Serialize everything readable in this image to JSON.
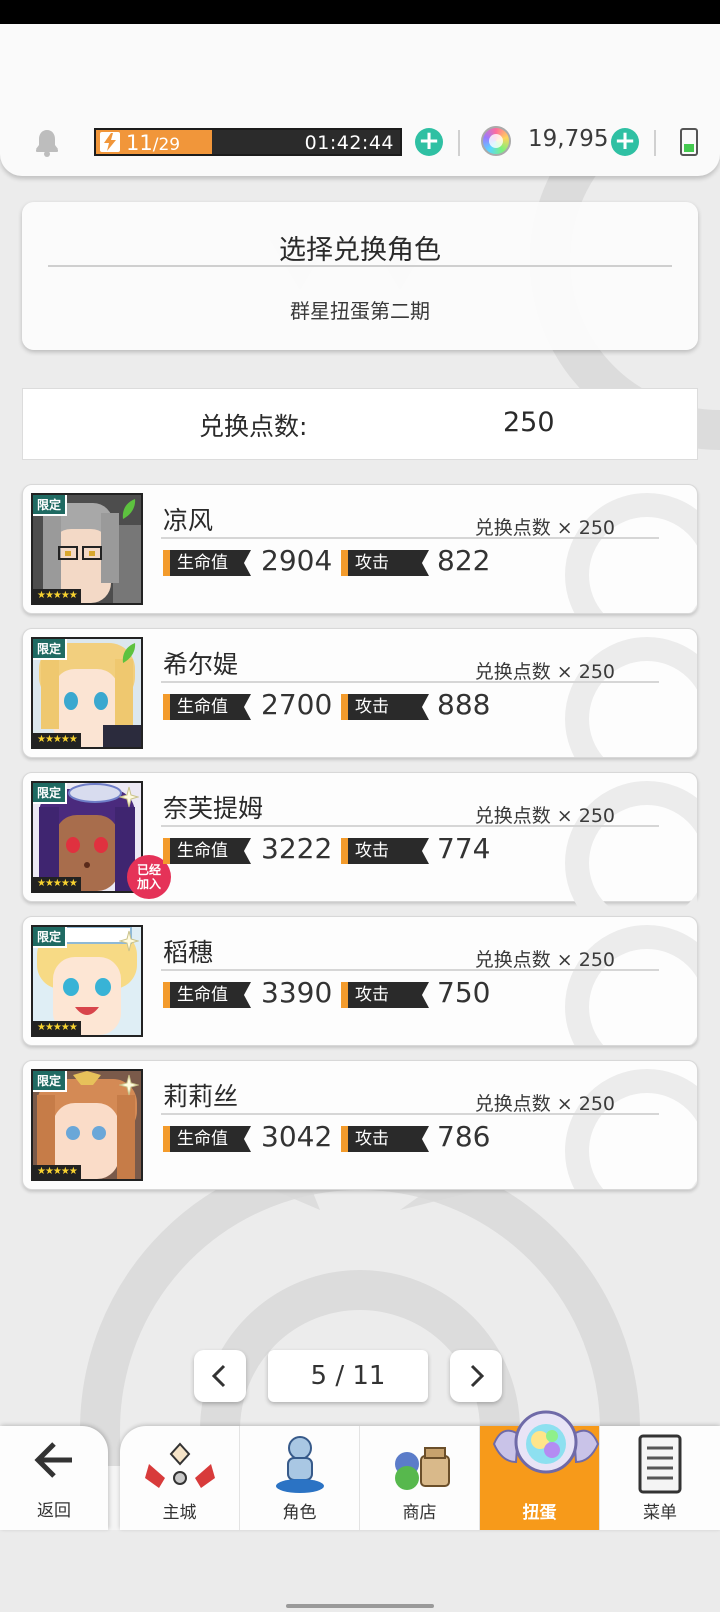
{
  "top_bar": {
    "stamina_current": "11",
    "stamina_separator": "/",
    "stamina_max": "29",
    "stamina_fraction": 0.38,
    "stamina_timer": "01:42:44",
    "currency_amount": "19,795",
    "icons": [
      "bell-icon",
      "lightning-icon",
      "add-icon",
      "gem-icon",
      "battery-icon"
    ]
  },
  "header": {
    "title": "选择兑换角色",
    "subtitle": "群星扭蛋第二期"
  },
  "points": {
    "label": "兑换点数:",
    "value": "250"
  },
  "characters": [
    {
      "name": "凉风",
      "cost": "兑换点数 × 250",
      "hp_label": "生命值",
      "hp": "2904",
      "atk_label": "攻击",
      "atk": "822",
      "tag": "限定",
      "stars": "★★★★★",
      "attribute": "leaf",
      "joined": ""
    },
    {
      "name": "希尔媞",
      "cost": "兑换点数 × 250",
      "hp_label": "生命值",
      "hp": "2700",
      "atk_label": "攻击",
      "atk": "888",
      "tag": "限定",
      "stars": "★★★★★",
      "attribute": "leaf",
      "joined": ""
    },
    {
      "name": "奈芙提姆",
      "cost": "兑换点数 × 250",
      "hp_label": "生命值",
      "hp": "3222",
      "atk_label": "攻击",
      "atk": "774",
      "tag": "限定",
      "stars": "★★★★★",
      "attribute": "light",
      "joined": "已经\n加入"
    },
    {
      "name": "稻穗",
      "cost": "兑换点数 × 250",
      "hp_label": "生命值",
      "hp": "3390",
      "atk_label": "攻击",
      "atk": "750",
      "tag": "限定",
      "stars": "★★★★★",
      "attribute": "light",
      "joined": ""
    },
    {
      "name": "莉莉丝",
      "cost": "兑换点数 × 250",
      "hp_label": "生命值",
      "hp": "3042",
      "atk_label": "攻击",
      "atk": "786",
      "tag": "限定",
      "stars": "★★★★★",
      "attribute": "light",
      "joined": ""
    }
  ],
  "pagination": {
    "page": "5 / 11"
  },
  "bottom_nav": {
    "back_label": "返回",
    "tabs": [
      {
        "label": "主城",
        "icon": "castle-icon"
      },
      {
        "label": "角色",
        "icon": "character-icon"
      },
      {
        "label": "商店",
        "icon": "shop-icon"
      },
      {
        "label": "扭蛋",
        "icon": "gacha-icon",
        "active": true
      },
      {
        "label": "菜单",
        "icon": "menu-icon"
      }
    ]
  },
  "colors": {
    "accent_orange": "#f39b2c",
    "plus_green": "#2fc0a3",
    "badge_red": "#e53258",
    "active_tab": "#f79a1a"
  }
}
